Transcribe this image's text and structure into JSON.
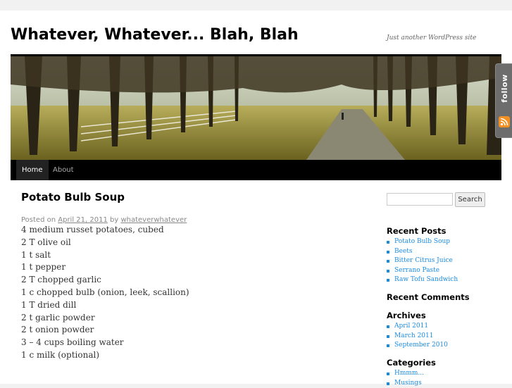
{
  "site": {
    "title": "Whatever, Whatever... Blah, Blah",
    "description": "Just another WordPress site"
  },
  "nav": {
    "items": [
      {
        "label": "Home",
        "current": true
      },
      {
        "label": "About",
        "current": false
      }
    ]
  },
  "follow": {
    "label": "follow"
  },
  "post": {
    "title": "Potato Bulb Soup",
    "meta_prefix": "Posted on",
    "date": "April 21, 2011",
    "by": "by",
    "author": "whateverwhatever",
    "lines": [
      "4 medium russet potatoes, cubed",
      "2 T olive oil",
      "1 t salt",
      "1 t pepper",
      "2 T chopped garlic",
      "1 c chopped bulb (onion, leek, scallion)",
      "1 T dried dill",
      "2 t garlic powder",
      "2 t onion powder",
      "3 – 4 cups boiling water",
      "1 c milk (optional)"
    ]
  },
  "sidebar": {
    "search_button": "Search",
    "search_value": "",
    "recent_posts": {
      "title": "Recent Posts",
      "items": [
        "Potato Bulb Soup",
        "Beets",
        "Bitter Citrus Juice",
        "Serrano Paste",
        "Raw Tofu Sandwich"
      ]
    },
    "recent_comments": {
      "title": "Recent Comments"
    },
    "archives": {
      "title": "Archives",
      "items": [
        "April 2011",
        "March 2011",
        "September 2010"
      ]
    },
    "categories": {
      "title": "Categories",
      "items": [
        "Hmmm...",
        "Musings"
      ]
    }
  },
  "colors": {
    "link": "#1b8be0",
    "nav_bar": "#000000",
    "rss": "#f39024",
    "follow_tab": "#6d6d6d"
  }
}
